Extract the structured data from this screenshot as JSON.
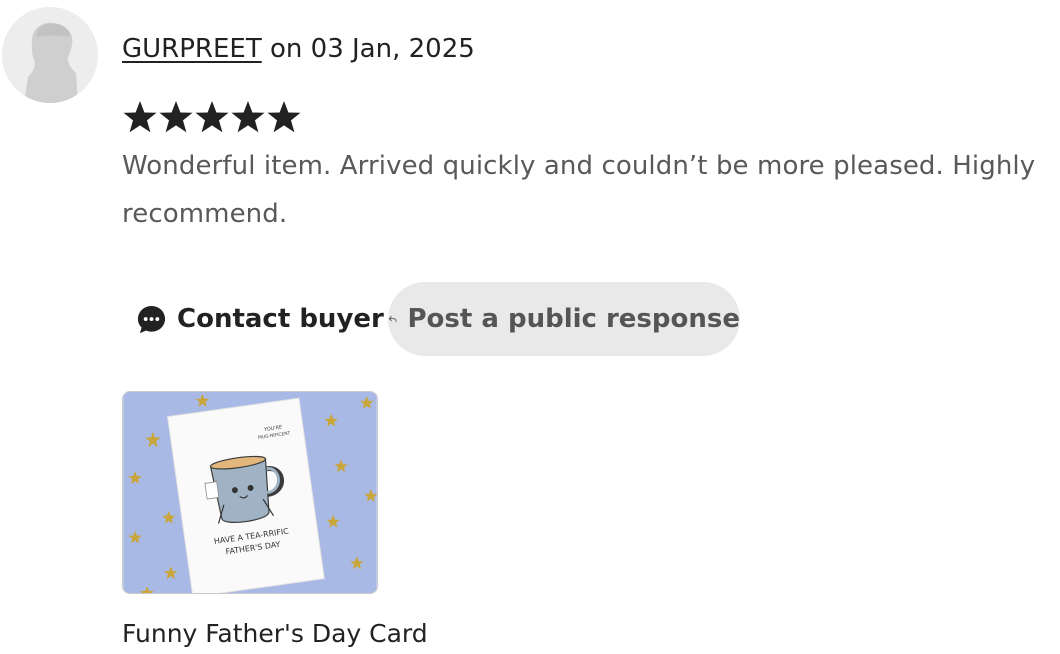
{
  "review": {
    "author": "GURPREET",
    "date_prefix": "on",
    "date": "03 Jan, 2025",
    "rating": 5,
    "rating_max": 5,
    "text": "Wonderful item. Arrived quickly and couldn’t be more pleased. Highly recommend."
  },
  "actions": {
    "contact_label": "Contact buyer",
    "contact_icon": "chat-bubble-icon",
    "response_label": "Post a public response",
    "response_icon": "reply-arrow-icon"
  },
  "product": {
    "title": "Funny Father's Day Card",
    "card_text_top_1": "YOU'RE",
    "card_text_top_2": "MUG-NIFICENT",
    "card_text_line_1": "HAVE A TEA-RRIFIC",
    "card_text_line_2": "FATHER'S DAY"
  },
  "colors": {
    "star": "#222222",
    "response_button_bg": "#e9e9e9",
    "card_background": "#a9b9e6"
  }
}
